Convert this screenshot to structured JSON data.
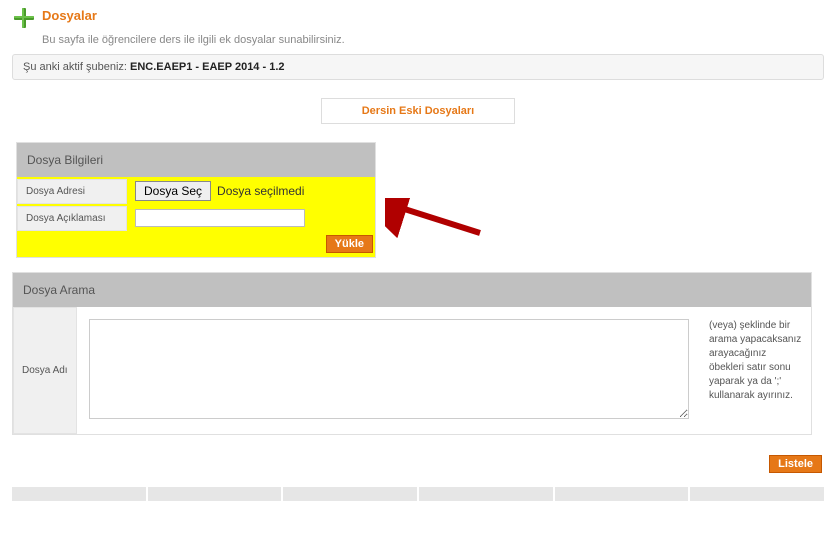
{
  "header": {
    "title": "Dosyalar",
    "subtitle": "Bu sayfa ile öğrencilere ders ile ilgili ek dosyalar sunabilirsiniz."
  },
  "active_branch": {
    "prefix": "Şu anki aktif şubeniz: ",
    "value": "ENC.EAEP1 - EAEP 2014 - 1.2"
  },
  "old_files_button": "Dersin Eski Dosyaları",
  "file_info": {
    "panel_title": "Dosya Bilgileri",
    "address_label": "Dosya Adresi",
    "choose_button": "Dosya Seç",
    "file_status": "Dosya seçilmedi",
    "desc_label": "Dosya Açıklaması",
    "desc_value": "",
    "upload_button": "Yükle"
  },
  "search": {
    "panel_title": "Dosya Arama",
    "name_label": "Dosya Adı",
    "textarea_value": "",
    "hint_text": "(veya) şeklinde bir arama yapacaksanız arayacağınız öbekleri satır sonu yaparak ya da ';' kullanarak ayırınız.",
    "list_button": "Listele"
  }
}
